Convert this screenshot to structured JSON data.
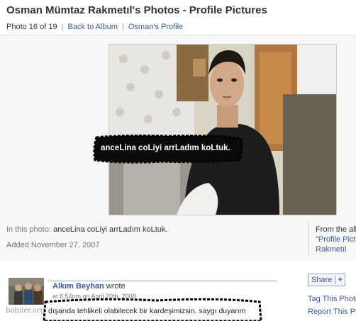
{
  "header": {
    "title": "Osman Mümtaz Rakmetıl's Photos - Profile Pictures",
    "photo_position": "Photo 16 of 19",
    "back_link": "Back to Album",
    "profile_link": "Osman's Profile",
    "separator": "|"
  },
  "photo": {
    "caption_tag": "anceLina coLiyi arrLadım koLtuk."
  },
  "meta": {
    "in_this_photo_label": "In this photo:",
    "in_this_photo_value": "anceLina coLiyi arrLadım koLtuk.",
    "added": "Added November 27, 2007"
  },
  "album_info": {
    "from_label": "From the alb",
    "album_name_1": "\"Profile Pictu",
    "album_name_2": "Rakmetıl"
  },
  "comment": {
    "author": "Alkım Beyhan",
    "wrote": "wrote",
    "time": "at 6:54pm on April 20th, 2008",
    "text": "dışarıda tehlikeli olabilecek bir kardeşimizsin. saygı duyarım",
    "watermark": "bobiler.org"
  },
  "actions": {
    "share_label": "Share",
    "share_plus": "+",
    "tag_photo": "Tag This Photo",
    "report_photo": "Report This Ph"
  },
  "colors": {
    "link": "#3b5998",
    "band_bg": "#f7f7f7"
  }
}
